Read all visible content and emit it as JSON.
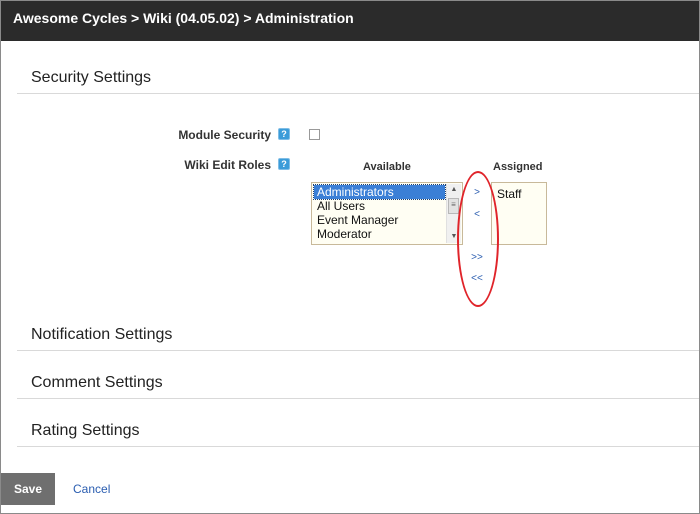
{
  "titlebar": {
    "breadcrumb": "Awesome Cycles > Wiki (04.05.02) > Administration"
  },
  "sections": {
    "security": "Security Settings",
    "notification": "Notification Settings",
    "comment": "Comment Settings",
    "rating": "Rating Settings"
  },
  "security": {
    "module_security_label": "Module Security",
    "module_security_checked": false,
    "wiki_edit_roles_label": "Wiki Edit Roles",
    "available_header": "Available",
    "assigned_header": "Assigned",
    "available_items": [
      "Administrators",
      "All Users",
      "Event Manager",
      "Moderator"
    ],
    "available_selected": "Administrators",
    "assigned_items": [
      "Staff"
    ],
    "buttons": {
      "add": ">",
      "remove": "<",
      "add_all": ">>",
      "remove_all": "<<"
    }
  },
  "icons": {
    "help": "help-icon",
    "help_glyph": "?",
    "scroll_up": "▲",
    "scroll_down": "▼",
    "scroll_grip": "≡"
  },
  "actions": {
    "save": "Save",
    "cancel": "Cancel"
  },
  "colors": {
    "titlebar_bg": "#2b2b2b",
    "annotation": "#e0242a",
    "link": "#2a5db0",
    "selected_item": "#3b7fd6"
  }
}
